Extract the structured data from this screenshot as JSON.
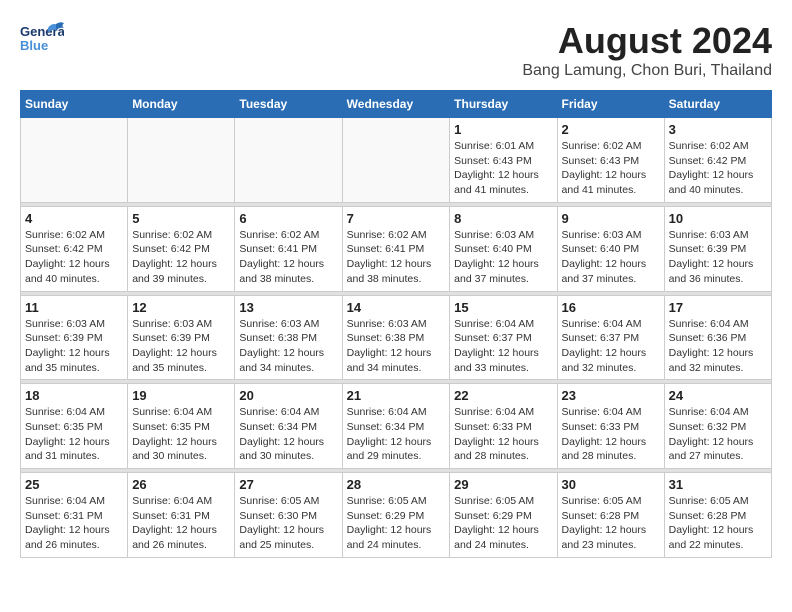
{
  "header": {
    "logo_general": "General",
    "logo_blue": "Blue",
    "month_year": "August 2024",
    "location": "Bang Lamung, Chon Buri, Thailand"
  },
  "weekdays": [
    "Sunday",
    "Monday",
    "Tuesday",
    "Wednesday",
    "Thursday",
    "Friday",
    "Saturday"
  ],
  "weeks": [
    [
      {
        "day": "",
        "info": ""
      },
      {
        "day": "",
        "info": ""
      },
      {
        "day": "",
        "info": ""
      },
      {
        "day": "",
        "info": ""
      },
      {
        "day": "1",
        "info": "Sunrise: 6:01 AM\nSunset: 6:43 PM\nDaylight: 12 hours\nand 41 minutes."
      },
      {
        "day": "2",
        "info": "Sunrise: 6:02 AM\nSunset: 6:43 PM\nDaylight: 12 hours\nand 41 minutes."
      },
      {
        "day": "3",
        "info": "Sunrise: 6:02 AM\nSunset: 6:42 PM\nDaylight: 12 hours\nand 40 minutes."
      }
    ],
    [
      {
        "day": "4",
        "info": "Sunrise: 6:02 AM\nSunset: 6:42 PM\nDaylight: 12 hours\nand 40 minutes."
      },
      {
        "day": "5",
        "info": "Sunrise: 6:02 AM\nSunset: 6:42 PM\nDaylight: 12 hours\nand 39 minutes."
      },
      {
        "day": "6",
        "info": "Sunrise: 6:02 AM\nSunset: 6:41 PM\nDaylight: 12 hours\nand 38 minutes."
      },
      {
        "day": "7",
        "info": "Sunrise: 6:02 AM\nSunset: 6:41 PM\nDaylight: 12 hours\nand 38 minutes."
      },
      {
        "day": "8",
        "info": "Sunrise: 6:03 AM\nSunset: 6:40 PM\nDaylight: 12 hours\nand 37 minutes."
      },
      {
        "day": "9",
        "info": "Sunrise: 6:03 AM\nSunset: 6:40 PM\nDaylight: 12 hours\nand 37 minutes."
      },
      {
        "day": "10",
        "info": "Sunrise: 6:03 AM\nSunset: 6:39 PM\nDaylight: 12 hours\nand 36 minutes."
      }
    ],
    [
      {
        "day": "11",
        "info": "Sunrise: 6:03 AM\nSunset: 6:39 PM\nDaylight: 12 hours\nand 35 minutes."
      },
      {
        "day": "12",
        "info": "Sunrise: 6:03 AM\nSunset: 6:39 PM\nDaylight: 12 hours\nand 35 minutes."
      },
      {
        "day": "13",
        "info": "Sunrise: 6:03 AM\nSunset: 6:38 PM\nDaylight: 12 hours\nand 34 minutes."
      },
      {
        "day": "14",
        "info": "Sunrise: 6:03 AM\nSunset: 6:38 PM\nDaylight: 12 hours\nand 34 minutes."
      },
      {
        "day": "15",
        "info": "Sunrise: 6:04 AM\nSunset: 6:37 PM\nDaylight: 12 hours\nand 33 minutes."
      },
      {
        "day": "16",
        "info": "Sunrise: 6:04 AM\nSunset: 6:37 PM\nDaylight: 12 hours\nand 32 minutes."
      },
      {
        "day": "17",
        "info": "Sunrise: 6:04 AM\nSunset: 6:36 PM\nDaylight: 12 hours\nand 32 minutes."
      }
    ],
    [
      {
        "day": "18",
        "info": "Sunrise: 6:04 AM\nSunset: 6:35 PM\nDaylight: 12 hours\nand 31 minutes."
      },
      {
        "day": "19",
        "info": "Sunrise: 6:04 AM\nSunset: 6:35 PM\nDaylight: 12 hours\nand 30 minutes."
      },
      {
        "day": "20",
        "info": "Sunrise: 6:04 AM\nSunset: 6:34 PM\nDaylight: 12 hours\nand 30 minutes."
      },
      {
        "day": "21",
        "info": "Sunrise: 6:04 AM\nSunset: 6:34 PM\nDaylight: 12 hours\nand 29 minutes."
      },
      {
        "day": "22",
        "info": "Sunrise: 6:04 AM\nSunset: 6:33 PM\nDaylight: 12 hours\nand 28 minutes."
      },
      {
        "day": "23",
        "info": "Sunrise: 6:04 AM\nSunset: 6:33 PM\nDaylight: 12 hours\nand 28 minutes."
      },
      {
        "day": "24",
        "info": "Sunrise: 6:04 AM\nSunset: 6:32 PM\nDaylight: 12 hours\nand 27 minutes."
      }
    ],
    [
      {
        "day": "25",
        "info": "Sunrise: 6:04 AM\nSunset: 6:31 PM\nDaylight: 12 hours\nand 26 minutes."
      },
      {
        "day": "26",
        "info": "Sunrise: 6:04 AM\nSunset: 6:31 PM\nDaylight: 12 hours\nand 26 minutes."
      },
      {
        "day": "27",
        "info": "Sunrise: 6:05 AM\nSunset: 6:30 PM\nDaylight: 12 hours\nand 25 minutes."
      },
      {
        "day": "28",
        "info": "Sunrise: 6:05 AM\nSunset: 6:29 PM\nDaylight: 12 hours\nand 24 minutes."
      },
      {
        "day": "29",
        "info": "Sunrise: 6:05 AM\nSunset: 6:29 PM\nDaylight: 12 hours\nand 24 minutes."
      },
      {
        "day": "30",
        "info": "Sunrise: 6:05 AM\nSunset: 6:28 PM\nDaylight: 12 hours\nand 23 minutes."
      },
      {
        "day": "31",
        "info": "Sunrise: 6:05 AM\nSunset: 6:28 PM\nDaylight: 12 hours\nand 22 minutes."
      }
    ]
  ]
}
